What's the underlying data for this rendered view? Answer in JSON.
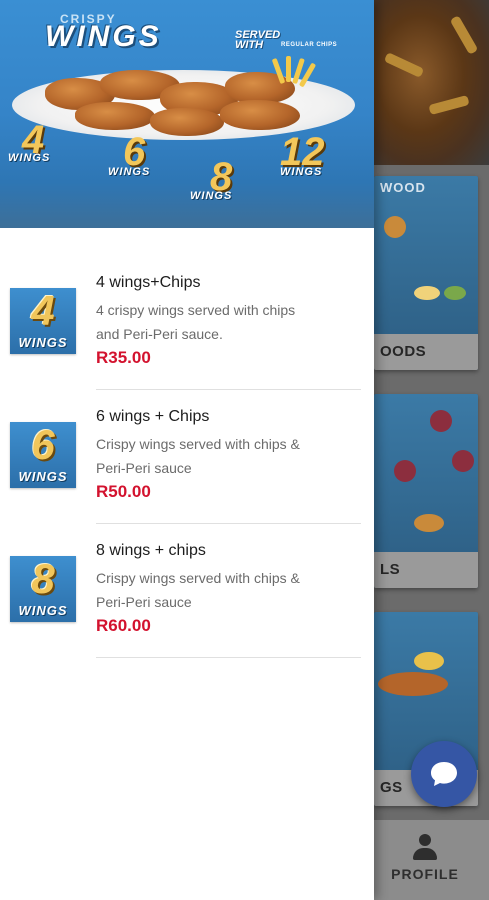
{
  "banner": {
    "subtitle": "CRISPY",
    "title": "WINGS",
    "served_line1": "SERVED",
    "served_line2": "WITH",
    "served_extra": "REGULAR CHIPS",
    "options": [
      {
        "number": "4",
        "label": "WINGS"
      },
      {
        "number": "6",
        "label": "WINGS"
      },
      {
        "number": "8",
        "label": "WINGS"
      },
      {
        "number": "12",
        "label": "WINGS"
      }
    ]
  },
  "menu": {
    "items": [
      {
        "thumb_number": "4",
        "thumb_label": "WINGS",
        "name": "4 wings+Chips",
        "desc_line1": "4 crispy wings served with chips",
        "desc_line2": "and Peri-Peri sauce.",
        "price": "R35.00"
      },
      {
        "thumb_number": "6",
        "thumb_label": "WINGS",
        "name": "6 wings + Chips",
        "desc_line1": "Crispy wings served with chips &",
        "desc_line2": "Peri-Peri sauce",
        "price": "R50.00"
      },
      {
        "thumb_number": "8",
        "thumb_label": "WINGS",
        "name": "8 wings + chips",
        "desc_line1": "Crispy wings served with chips &",
        "desc_line2": "Peri-Peri sauce",
        "price": "R60.00"
      }
    ]
  },
  "background": {
    "card1_title": "WOOD",
    "card1_label": "OODS",
    "card2_label": "LS",
    "card3_label": "GS"
  },
  "bottom_nav": {
    "profile_label": "PROFILE",
    "profile_icon": "person-icon"
  },
  "fab": {
    "icon": "chat-icon"
  },
  "colors": {
    "price": "#d3122e",
    "fab": "#3556a5",
    "banner_blue": "#3584c8"
  }
}
